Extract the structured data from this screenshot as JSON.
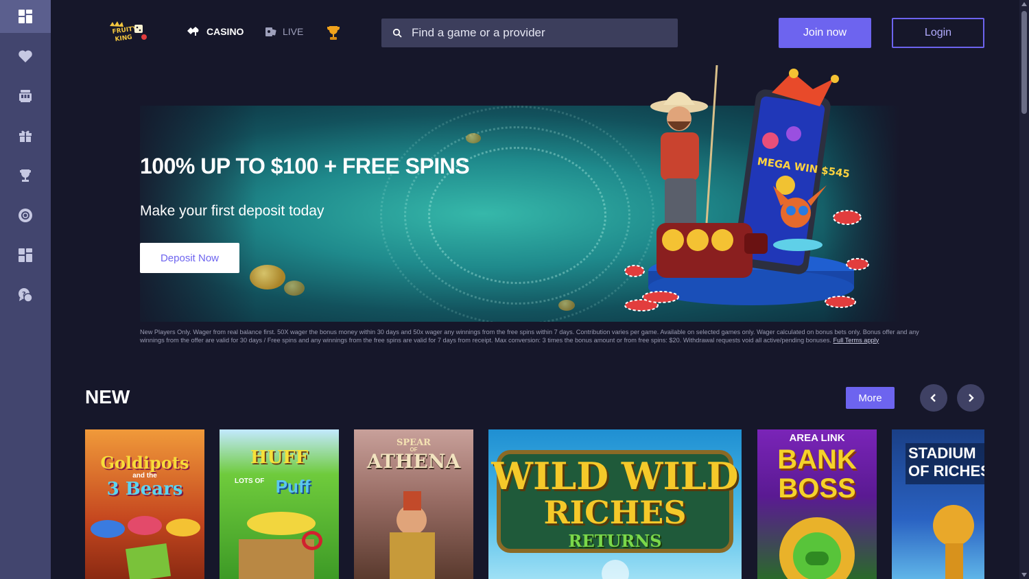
{
  "sidebar": {
    "items": [
      {
        "name": "dashboard",
        "icon": "dashboard-icon",
        "active": true
      },
      {
        "name": "favorites",
        "icon": "heart-icon"
      },
      {
        "name": "promotions",
        "icon": "casino-icon"
      },
      {
        "name": "gifts",
        "icon": "gift-icon"
      },
      {
        "name": "tournaments",
        "icon": "trophy-icon"
      },
      {
        "name": "support",
        "icon": "lifebuoy-icon"
      },
      {
        "name": "categories",
        "icon": "grid-icon"
      },
      {
        "name": "help",
        "icon": "chat-help-icon"
      }
    ]
  },
  "header": {
    "logo_text": "FRUITY KING",
    "nav": {
      "casino": "CASINO",
      "live": "LIVE"
    },
    "search_placeholder": "Find a game or a provider",
    "join_label": "Join now",
    "login_label": "Login"
  },
  "banner": {
    "title": "100% UP TO $100 + FREE SPINS",
    "subtitle": "Make your first deposit today",
    "cta": "Deposit Now",
    "screen_text": "MEGA WIN $545",
    "terms": "New Players Only. Wager from real balance first. 50X wager the bonus money within 30 days and 50x wager any winnings from the free spins within 7 days. Contribution varies per game. Available on selected games only. Wager calculated on bonus bets only. Bonus offer and any winnings from the offer are valid for 30 days / Free spins and any winnings from the free spins are valid for 7 days from receipt. Max conversion: 3 times the bonus amount or from free spins: $20. Withdrawal requests void all active/pending bonuses.",
    "terms_link": "Full Terms apply"
  },
  "section": {
    "title": "NEW",
    "more_label": "More"
  },
  "games": [
    {
      "title_line1": "Goldipots",
      "title_small": "and the",
      "title_line2": "3 Bears"
    },
    {
      "title_line1": "HUFF",
      "title_small": "LOTS OF",
      "title_line2": "Puff"
    },
    {
      "title_line1": "SPEAR",
      "title_small": "OF",
      "title_line2": "ATHENA"
    },
    {
      "title_line1": "WILD WILD",
      "title_line2": "RICHES",
      "title_line3": "RETURNS"
    },
    {
      "title_small": "AREA LINK",
      "title_line1": "BANK",
      "title_line2": "BOSS"
    },
    {
      "title_line1": "STADIUM",
      "title_line2": "OF RICHES"
    }
  ],
  "colors": {
    "accent": "#6d64ef",
    "sidebar": "#42456e",
    "background": "#16172a"
  }
}
